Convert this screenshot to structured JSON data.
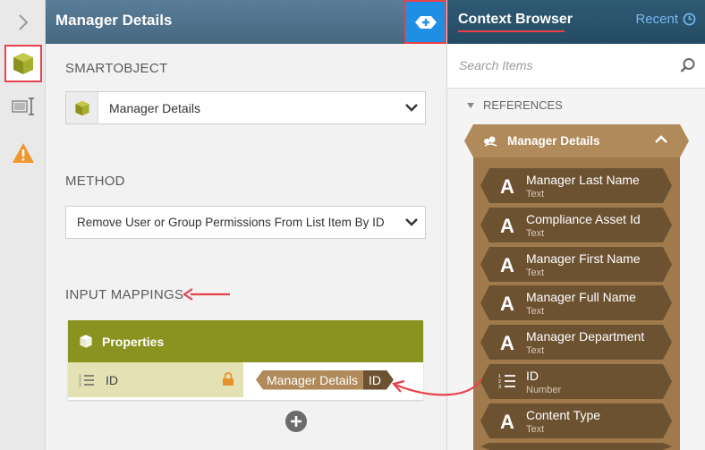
{
  "rail": {
    "tools": [
      {
        "name": "smartobject-tool",
        "icon": "cube-icon",
        "active": true
      },
      {
        "name": "form-control-tool",
        "icon": "textbox-cursor-icon",
        "active": false
      },
      {
        "name": "warning-tool",
        "icon": "warning-icon",
        "active": false
      }
    ]
  },
  "main": {
    "title": "Manager Details",
    "smartobject_label": "SMARTOBJECT",
    "smartobject_value": "Manager Details",
    "method_label": "METHOD",
    "method_value": "Remove User or Group Permissions From List Item By ID",
    "input_mappings_label": "INPUT MAPPINGS",
    "properties": {
      "header": "Properties",
      "rows": [
        {
          "name": "ID",
          "mapped_object": "Manager Details",
          "mapped_field": "ID"
        }
      ]
    }
  },
  "context_browser": {
    "title": "Context Browser",
    "recent_label": "Recent",
    "search_placeholder": "Search Items",
    "references_label": "REFERENCES",
    "smartobject": "Manager Details",
    "fields": [
      {
        "icon": "text-icon",
        "glyph": "A",
        "name": "Manager Last Name",
        "type": "Text"
      },
      {
        "icon": "text-icon",
        "glyph": "A",
        "name": "Compliance Asset Id",
        "type": "Text"
      },
      {
        "icon": "text-icon",
        "glyph": "A",
        "name": "Manager First Name",
        "type": "Text"
      },
      {
        "icon": "text-icon",
        "glyph": "A",
        "name": "Manager Full Name",
        "type": "Text"
      },
      {
        "icon": "text-icon",
        "glyph": "A",
        "name": "Manager Department",
        "type": "Text"
      },
      {
        "icon": "number-icon",
        "glyph": "",
        "name": "ID",
        "type": "Number"
      },
      {
        "icon": "text-icon",
        "glyph": "A",
        "name": "Content Type",
        "type": "Text"
      }
    ]
  },
  "colors": {
    "highlight": "#e8414a",
    "header_blue": "#46687f",
    "accent_blue": "#1f8fe6",
    "olive": "#8a9220",
    "smartobject_brown": "#b08a5a",
    "field_brown": "#6d5232"
  }
}
